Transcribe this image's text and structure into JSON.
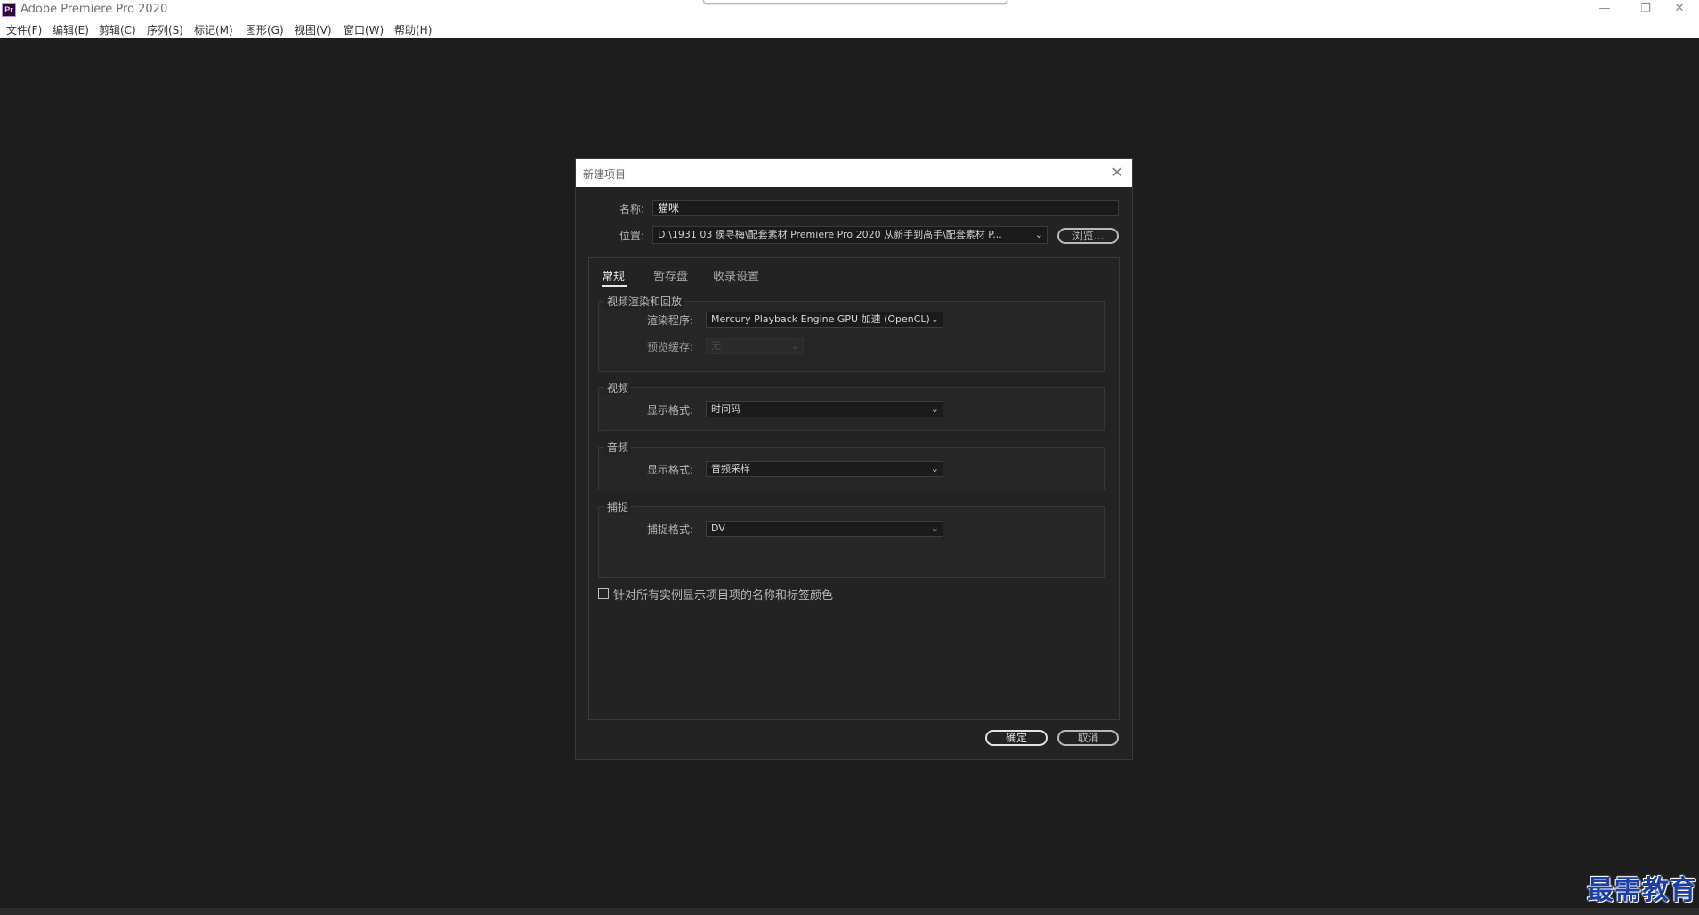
{
  "app": {
    "icon_text": "Pr",
    "title": "Adobe Premiere Pro 2020",
    "window_controls": {
      "minimize": "—",
      "restore": "❐",
      "close": "✕"
    }
  },
  "menu": [
    "文件(F)",
    "编辑(E)",
    "剪辑(C)",
    "序列(S)",
    "标记(M)",
    "图形(G)",
    "视图(V)",
    "窗口(W)",
    "帮助(H)"
  ],
  "dialog": {
    "title": "新建项目",
    "close_icon": "✕",
    "name_label": "名称:",
    "name_value": "猫咪",
    "location_label": "位置:",
    "location_value": "D:\\1931 03 侯寻梅\\配套素材 Premiere Pro 2020 从新手到高手\\配套素材 P...",
    "browse_label": "浏览...",
    "tabs": [
      "常规",
      "暂存盘",
      "收录设置"
    ],
    "active_tab": 0,
    "groups": {
      "render": {
        "title": "视频渲染和回放",
        "renderer_label": "渲染程序:",
        "renderer_value": "Mercury Playback Engine GPU 加速 (OpenCL)",
        "preview_cache_label": "预览缓存:",
        "preview_cache_value": "无"
      },
      "video": {
        "title": "视频",
        "display_format_label": "显示格式:",
        "display_format_value": "时间码"
      },
      "audio": {
        "title": "音频",
        "display_format_label": "显示格式:",
        "display_format_value": "音频采样"
      },
      "capture": {
        "title": "捕捉",
        "capture_format_label": "捕捉格式:",
        "capture_format_value": "DV"
      }
    },
    "checkbox_label": "针对所有实例显示项目项的名称和标签颜色",
    "checkbox_checked": false,
    "ok_label": "确定",
    "cancel_label": "取消"
  },
  "watermark": "最需教育",
  "colors": {
    "workspace": "#1d1d1d",
    "dialog_bg": "#232323",
    "watermark": "#1b3ea8"
  }
}
